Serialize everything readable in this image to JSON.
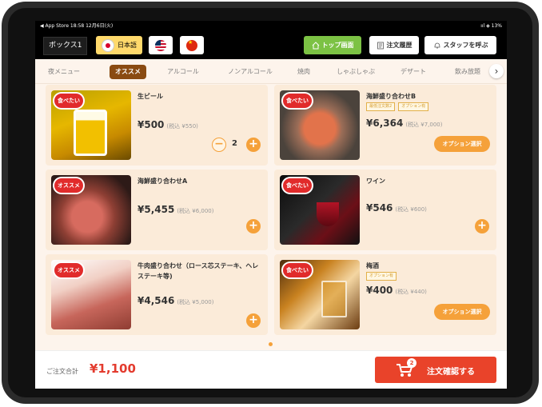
{
  "status_bar": {
    "left": "◀ App Store  18:58  12月6日(火)",
    "right": "ııl ◈ 13%"
  },
  "topbar": {
    "box_label": "ボックス1",
    "lang_jp": "日本語",
    "top_button": "トップ画面",
    "history_button": "注文履歴",
    "staff_button": "スタッフを呼ぶ"
  },
  "tabs": [
    {
      "label": "夜メニュー"
    },
    {
      "label": "オススメ",
      "active": true
    },
    {
      "label": "アルコール"
    },
    {
      "label": "ノンアルコール"
    },
    {
      "label": "焼肉"
    },
    {
      "label": "しゃぶしゃぶ"
    },
    {
      "label": "デザート"
    },
    {
      "label": "飲み放題"
    }
  ],
  "items": [
    {
      "name": "生ビール",
      "price": "¥500",
      "tax": "(税込 ¥550)",
      "qty": "2",
      "badge": "食べたい"
    },
    {
      "name": "海鮮盛り合わせB",
      "tags": [
        "最低注文数2",
        "オプション有"
      ],
      "price": "¥6,364",
      "tax": "(税込 ¥7,000)",
      "option": "オプション選択",
      "badge": "食べたい"
    },
    {
      "name": "海鮮盛り合わせA",
      "price": "¥5,455",
      "tax": "(税込 ¥6,000)",
      "badge": "オススメ"
    },
    {
      "name": "ワイン",
      "price": "¥546",
      "tax": "(税込 ¥600)",
      "badge": "食べたい"
    },
    {
      "name": "牛肉盛り合わせ（ロース芯ステーキ、ヘレステーキ等)",
      "price": "¥4,546",
      "tax": "(税込 ¥5,000)",
      "badge": "オススメ"
    },
    {
      "name": "梅酒",
      "tags": [
        "オプション有"
      ],
      "price": "¥400",
      "tax": "(税込 ¥440)",
      "option": "オプション選択",
      "badge": "食べたい"
    }
  ],
  "footer": {
    "total_label": "ご注文合計",
    "total_value": "¥1,100",
    "cart_count": "2",
    "confirm_label": "注文確認する"
  },
  "colors": {
    "accent": "#f5a13a",
    "primary_button": "#e9432a",
    "active_tab": "#8a4b12",
    "top_button": "#7cc244"
  }
}
